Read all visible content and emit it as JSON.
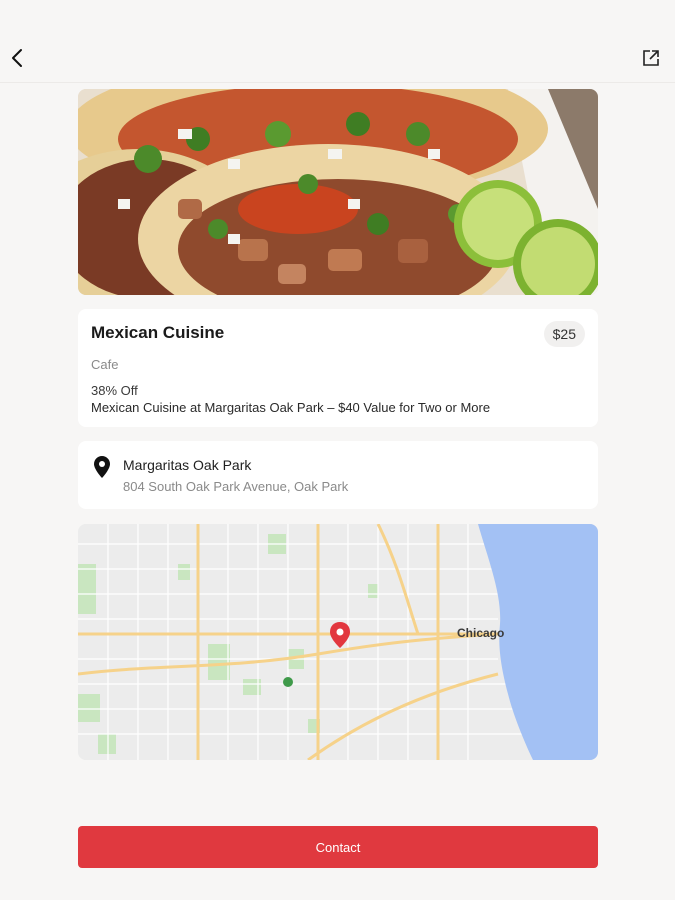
{
  "header": {
    "back_icon": "chevron-left-icon",
    "share_icon": "external-share-icon"
  },
  "deal": {
    "title": "Mexican Cuisine",
    "price": "$25",
    "category": "Cafe",
    "discount": "38% Off",
    "description": "Mexican Cuisine at Margaritas Oak Park – $40 Value for Two or More"
  },
  "location": {
    "icon": "location-pin-icon",
    "venue": "Margaritas Oak Park",
    "address": "804 South Oak Park Avenue, Oak Park"
  },
  "map": {
    "city_label": "Chicago",
    "colors": {
      "water": "#a3c1f4",
      "land": "#eeeeee",
      "road": "#f6d28a",
      "park": "#c9e6c0",
      "pin": "#e2373f"
    }
  },
  "actions": {
    "contact_label": "Contact"
  },
  "colors": {
    "accent": "#e0393f"
  }
}
